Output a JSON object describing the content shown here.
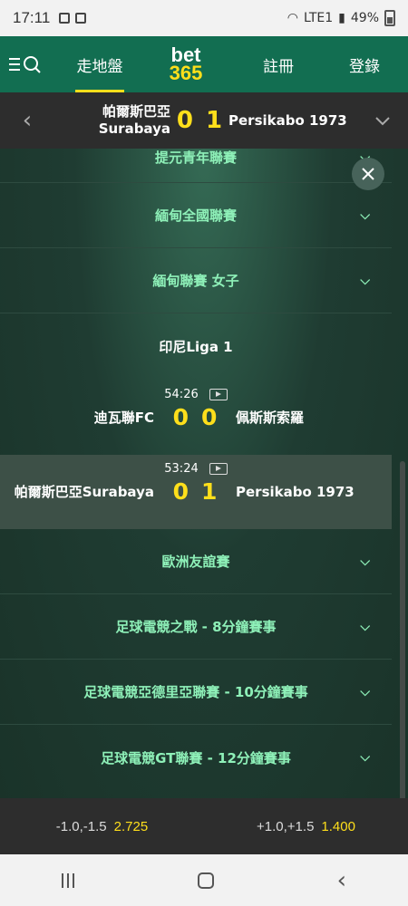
{
  "status": {
    "time": "17:11",
    "battery": "49%",
    "network": "LTE1"
  },
  "header": {
    "nav_live": "走地盤",
    "logo_top": "bet",
    "logo_bottom": "365",
    "nav_register": "註冊",
    "nav_login": "登錄"
  },
  "match_header": {
    "home_line1": "帕爾斯巴亞",
    "home_line2": "Surabaya",
    "home_score": "0",
    "away_score": "1",
    "away": "Persikabo 1973"
  },
  "leagues_top": [
    {
      "name": "提元青年聯賽"
    },
    {
      "name": "緬甸全國聯賽"
    },
    {
      "name": "緬甸聯賽 女子"
    }
  ],
  "open_league": {
    "name": "印尼Liga 1"
  },
  "events": [
    {
      "time": "54:26",
      "home": "迪瓦聯FC",
      "home_score": "0",
      "away_score": "0",
      "away": "佩斯斯索羅"
    },
    {
      "time": "53:24",
      "home": "帕爾斯巴亞Surabaya",
      "home_score": "0",
      "away_score": "1",
      "away": "Persikabo 1973"
    }
  ],
  "leagues_bottom": [
    {
      "name": "歐洲友誼賽"
    },
    {
      "name": "足球電競之戰 - 8分鐘賽事"
    },
    {
      "name": "足球電競亞德里亞聯賽 - 10分鐘賽事"
    },
    {
      "name": "足球電競GT聯賽 - 12分鐘賽事"
    }
  ],
  "bets": [
    {
      "handicap": "-1.0,-1.5",
      "odds": "2.725"
    },
    {
      "handicap": "+1.0,+1.5",
      "odds": "1.400"
    }
  ],
  "colors": {
    "accent": "#ffdf1b",
    "league_text": "#8ef0b8",
    "header_green": "#126e51"
  }
}
